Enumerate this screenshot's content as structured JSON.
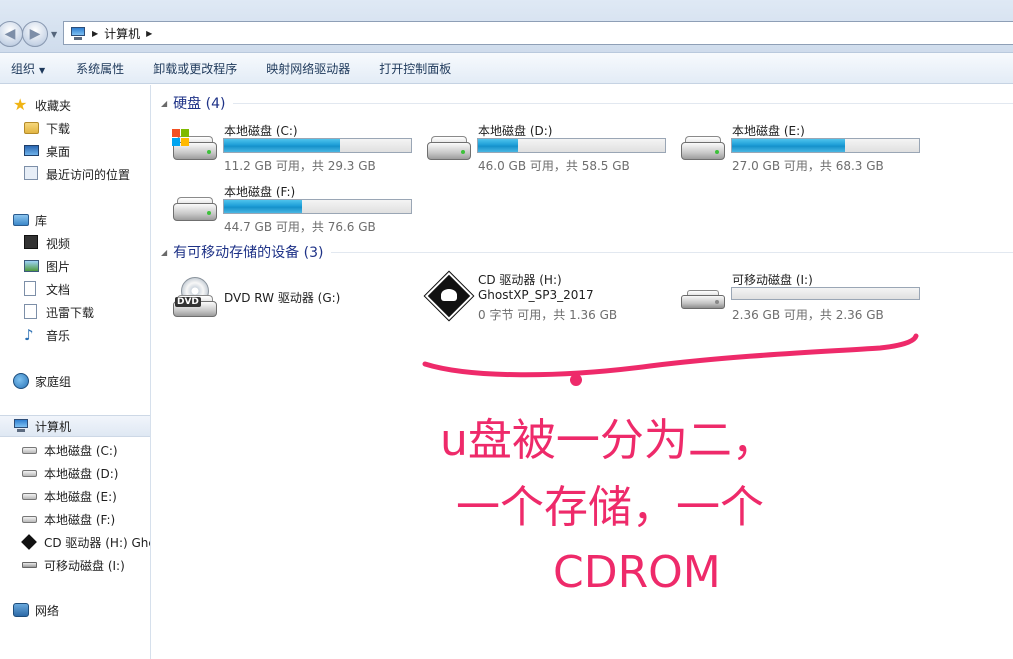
{
  "address": {
    "crumbs": [
      "计算机"
    ],
    "icon": "computer-icon"
  },
  "toolbar": {
    "organize": "组织",
    "items": [
      "系统属性",
      "卸载或更改程序",
      "映射网络驱动器",
      "打开控制面板"
    ]
  },
  "nav": {
    "favorites": {
      "label": "收藏夹",
      "icon": "star-icon"
    },
    "fav_items": [
      {
        "label": "下载",
        "icon": "downloads-folder-icon"
      },
      {
        "label": "桌面",
        "icon": "desktop-icon"
      },
      {
        "label": "最近访问的位置",
        "icon": "recent-places-icon"
      }
    ],
    "libraries": {
      "label": "库",
      "icon": "library-icon"
    },
    "lib_items": [
      {
        "label": "视频",
        "icon": "video-icon"
      },
      {
        "label": "图片",
        "icon": "pictures-icon"
      },
      {
        "label": "文档",
        "icon": "documents-icon"
      },
      {
        "label": "迅雷下载",
        "icon": "thunder-download-icon"
      },
      {
        "label": "音乐",
        "icon": "music-icon"
      }
    ],
    "homegroup": {
      "label": "家庭组",
      "icon": "homegroup-icon"
    },
    "computer": {
      "label": "计算机",
      "icon": "computer-icon"
    },
    "computer_items": [
      {
        "label": "本地磁盘 (C:)",
        "icon": "system-drive-icon"
      },
      {
        "label": "本地磁盘 (D:)",
        "icon": "hard-drive-icon"
      },
      {
        "label": "本地磁盘 (E:)",
        "icon": "hard-drive-icon"
      },
      {
        "label": "本地磁盘 (F:)",
        "icon": "hard-drive-icon"
      },
      {
        "label": "CD 驱动器 (H:) Ghc",
        "icon": "cd-drive-icon"
      },
      {
        "label": "可移动磁盘 (I:)",
        "icon": "removable-drive-icon"
      }
    ],
    "network": {
      "label": "网络",
      "icon": "network-icon"
    }
  },
  "content": {
    "hdd_group": {
      "title": "硬盘 (4)"
    },
    "removable_group": {
      "title": "有可移动存储的设备 (3)"
    },
    "hdds": [
      {
        "name": "本地磁盘 (C:)",
        "info": "11.2 GB 可用，共 29.3 GB",
        "used_fraction": 0.618,
        "icon": "system-drive-icon"
      },
      {
        "name": "本地磁盘 (D:)",
        "info": "46.0 GB 可用，共 58.5 GB",
        "used_fraction": 0.214,
        "icon": "hard-drive-icon"
      },
      {
        "name": "本地磁盘 (E:)",
        "info": "27.0 GB 可用，共 68.3 GB",
        "used_fraction": 0.605,
        "icon": "hard-drive-icon"
      },
      {
        "name": "本地磁盘 (F:)",
        "info": "44.7 GB 可用，共 76.6 GB",
        "used_fraction": 0.416,
        "icon": "hard-drive-icon"
      }
    ],
    "removables": [
      {
        "name": "DVD RW 驱动器 (G:)",
        "icon": "dvd-drive-icon"
      },
      {
        "name": "CD 驱动器 (H:)",
        "label": "GhostXP_SP3_2017",
        "info": "0 字节 可用，共 1.36 GB",
        "icon": "ghost-cd-icon"
      },
      {
        "name": "可移动磁盘 (I:)",
        "info": "2.36 GB 可用，共 2.36 GB",
        "used_fraction": 0.0,
        "icon": "removable-drive-icon"
      }
    ]
  },
  "annotation": {
    "lines": [
      "u盘被一分为二，",
      "一个存储，一个",
      "CDROM"
    ],
    "color": "#ee2a6a"
  }
}
